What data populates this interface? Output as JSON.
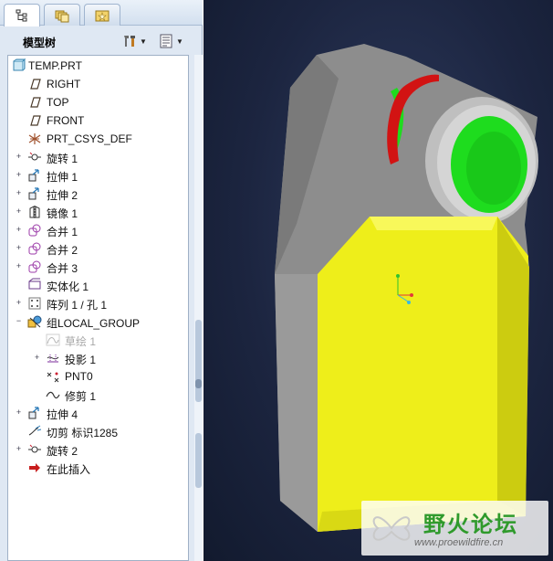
{
  "tabs": [
    {
      "name": "model-tree-tab",
      "icon": "model-tree-icon",
      "active": true
    },
    {
      "name": "layers-tab",
      "icon": "folder-browser-icon",
      "active": false
    },
    {
      "name": "favorites-tab",
      "icon": "favorites-icon",
      "active": false
    }
  ],
  "panel": {
    "title": "模型树",
    "settings_icon": "tools-icon",
    "show_icon": "list-icon"
  },
  "tree": {
    "items": [
      {
        "label": "TEMP.PRT",
        "icon": "part-icon",
        "expander": ""
      },
      {
        "label": "RIGHT",
        "icon": "datum-plane-icon",
        "expander": ""
      },
      {
        "label": "TOP",
        "icon": "datum-plane-icon",
        "expander": ""
      },
      {
        "label": "FRONT",
        "icon": "datum-plane-icon",
        "expander": ""
      },
      {
        "label": "PRT_CSYS_DEF",
        "icon": "csys-icon",
        "expander": ""
      },
      {
        "label": "旋转 1",
        "icon": "revolve-icon",
        "expander": "+"
      },
      {
        "label": "拉伸 1",
        "icon": "extrude-icon",
        "expander": "+"
      },
      {
        "label": "拉伸 2",
        "icon": "extrude-icon",
        "expander": "+"
      },
      {
        "label": "镜像 1",
        "icon": "mirror-icon",
        "expander": "+"
      },
      {
        "label": "合并 1",
        "icon": "merge-icon",
        "expander": "+"
      },
      {
        "label": "合并 2",
        "icon": "merge-icon",
        "expander": "+"
      },
      {
        "label": "合并 3",
        "icon": "merge-icon",
        "expander": "+"
      },
      {
        "label": "实体化 1",
        "icon": "solidify-icon",
        "expander": ""
      },
      {
        "label": "阵列 1 / 孔 1",
        "icon": "pattern-icon",
        "expander": "+"
      },
      {
        "label": "组LOCAL_GROUP",
        "icon": "group-icon",
        "expander": "−"
      },
      {
        "label": "草绘 1",
        "icon": "sketch-icon",
        "expander": "",
        "dim": true
      },
      {
        "label": "投影 1",
        "icon": "project-icon",
        "expander": "+"
      },
      {
        "label": "PNT0",
        "icon": "datum-point-icon",
        "expander": ""
      },
      {
        "label": "修剪 1",
        "icon": "trim-icon",
        "expander": ""
      },
      {
        "label": "拉伸 4",
        "icon": "extrude-icon",
        "expander": "+"
      },
      {
        "label": "切剪 标识1285",
        "icon": "cut-icon",
        "expander": ""
      },
      {
        "label": "旋转 2",
        "icon": "revolve-icon",
        "expander": "+"
      },
      {
        "label": "在此插入",
        "icon": "insert-arrow-icon",
        "expander": ""
      }
    ]
  },
  "colors": {
    "viewport_bg": "#1c2540",
    "part_gray": "#8c8c8c",
    "face_yellow": "#eeee1a",
    "hole_green": "#1edc1e",
    "edge_red": "#d21313"
  },
  "watermark": {
    "title": "野火论坛",
    "url": "www.proewildfire.cn"
  }
}
